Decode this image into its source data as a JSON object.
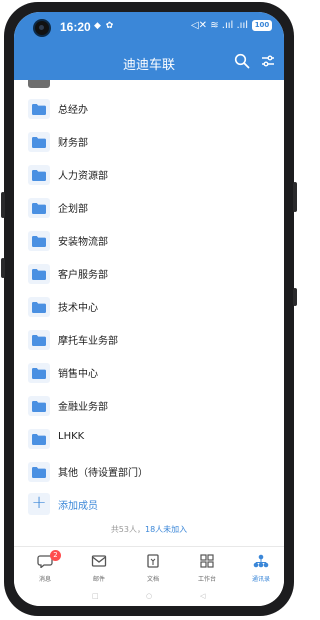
{
  "status_bar": {
    "time": "16:20",
    "left_icons": "◆ ✿",
    "right_icons": "◁✕ ≋ .ııl .ııl",
    "battery": "100"
  },
  "app_bar": {
    "title": "迪迪车联",
    "icons": [
      "search-icon",
      "filter-icon"
    ]
  },
  "departments": [
    {
      "label": "总经办"
    },
    {
      "label": "财务部"
    },
    {
      "label": "人力资源部"
    },
    {
      "label": "企划部"
    },
    {
      "label": "安装物流部"
    },
    {
      "label": "客户服务部"
    },
    {
      "label": "技术中心"
    },
    {
      "label": "摩托车业务部"
    },
    {
      "label": "销售中心"
    },
    {
      "label": "金融业务部"
    },
    {
      "label": "LHKK"
    },
    {
      "label": "其他（待设置部门）"
    }
  ],
  "add_member": "添加成员",
  "summary": {
    "total": "共53人，",
    "not_joined": "18人未加入"
  },
  "tabs": [
    {
      "label": "消息",
      "icon": "chat-icon",
      "badge": "2",
      "active": false
    },
    {
      "label": "邮件",
      "icon": "mail-icon",
      "active": false
    },
    {
      "label": "文档",
      "icon": "document-icon",
      "active": false
    },
    {
      "label": "工作台",
      "icon": "workbench-icon",
      "active": false
    },
    {
      "label": "通讯录",
      "icon": "contacts-icon",
      "active": true
    }
  ],
  "nav_bar": {
    "back": "◁",
    "home": "○",
    "recent": "□"
  },
  "colors": {
    "accent": "#3b87d8",
    "folder": "#4a90e2",
    "badge": "#ff4d4f"
  }
}
